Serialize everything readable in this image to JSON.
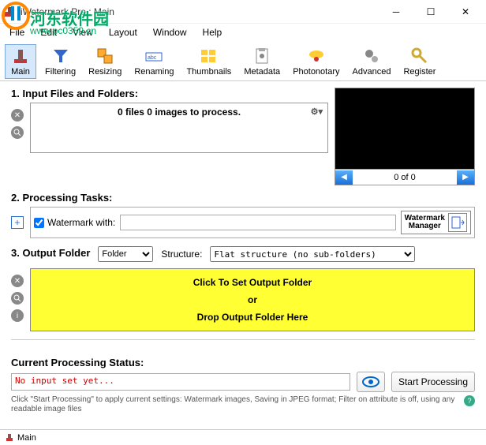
{
  "window": {
    "title": "iWatermark Pro : Main"
  },
  "watermark": {
    "text1": "河东软件园",
    "text2": "www.pc0359.cn"
  },
  "menu": {
    "file": "File",
    "edit": "Edit",
    "view": "View",
    "layout": "Layout",
    "window": "Window",
    "help": "Help"
  },
  "toolbar": {
    "main": "Main",
    "filtering": "Filtering",
    "resizing": "Resizing",
    "renaming": "Renaming",
    "thumbnails": "Thumbnails",
    "metadata": "Metadata",
    "photonotary": "Photonotary",
    "advanced": "Advanced",
    "register": "Register"
  },
  "sections": {
    "input_label": "1. Input Files and Folders:",
    "files_msg": "0 files 0 images to process.",
    "preview_nav": "0  of  0",
    "tasks_label": "2. Processing Tasks:",
    "watermark_chk": "Watermark with:",
    "wm_manager": "Watermark\nManager",
    "output_label": "3. Output Folder",
    "folder_opt": "Folder",
    "structure_label": "Structure:",
    "structure_opt": "Flat structure (no sub-folders)",
    "yellow1": "Click  To Set Output Folder",
    "yellow2": "or",
    "yellow3": "Drop Output Folder Here"
  },
  "status": {
    "label": "Current Processing Status:",
    "msg": "No input set yet...",
    "start": "Start Processing",
    "hint": "Click \"Start Processing\" to apply current settings: Watermark images, Saving in JPEG format; Filter on attribute is off, using any readable image files"
  },
  "footer": {
    "main": "Main"
  }
}
